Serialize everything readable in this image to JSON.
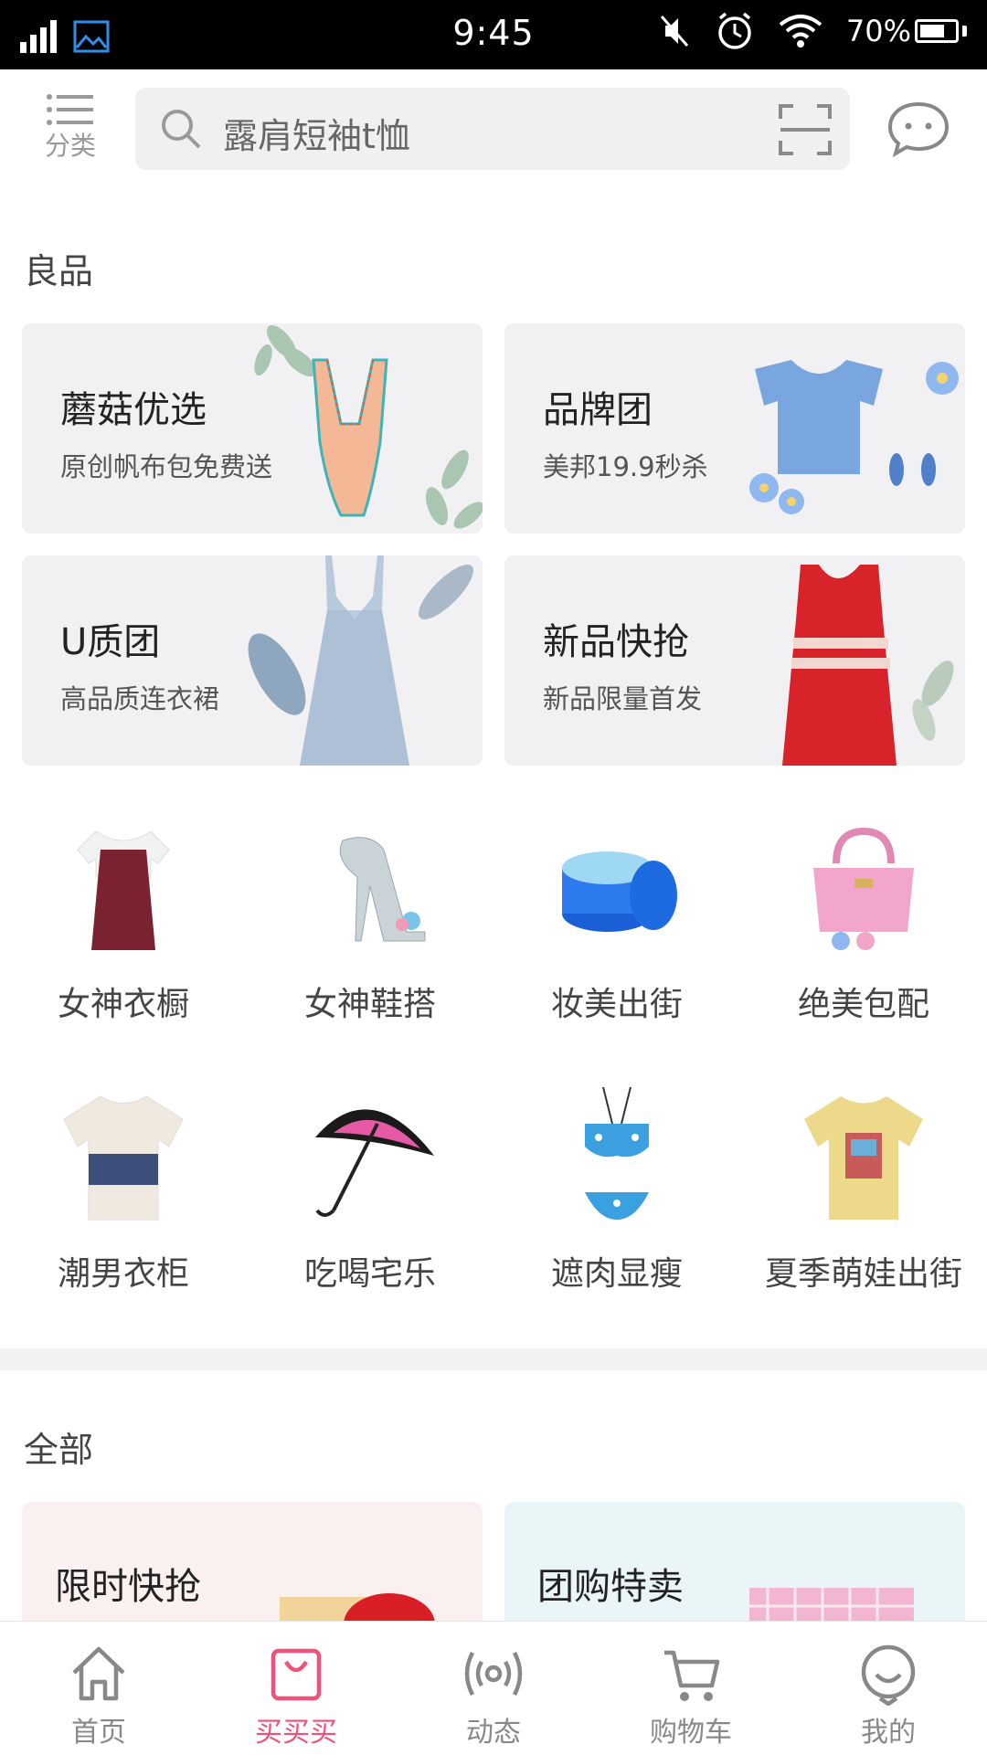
{
  "status_bar": {
    "time": "9:45",
    "battery": "70%"
  },
  "topbar": {
    "category_label": "分类",
    "search_placeholder": "露肩短袖t恤"
  },
  "sections": {
    "good_products": "良品",
    "all": "全部"
  },
  "feature_cards": [
    {
      "title": "蘑菇优选",
      "subtitle": "原创帆布包免费送"
    },
    {
      "title": "品牌团",
      "subtitle": "美邦19.9秒杀"
    },
    {
      "title": "U质团",
      "subtitle": "高品质连衣裙"
    },
    {
      "title": "新品快抢",
      "subtitle": "新品限量首发"
    }
  ],
  "categories": [
    {
      "label": "女神衣橱",
      "icon": "dress-icon"
    },
    {
      "label": "女神鞋搭",
      "icon": "heel-shoe-icon"
    },
    {
      "label": "妆美出街",
      "icon": "cosmetics-jar-icon"
    },
    {
      "label": "绝美包配",
      "icon": "handbag-icon"
    },
    {
      "label": "潮男衣柜",
      "icon": "tshirt-icon"
    },
    {
      "label": "吃喝宅乐",
      "icon": "umbrella-icon"
    },
    {
      "label": "遮肉显瘦",
      "icon": "bikini-icon"
    },
    {
      "label": "夏季萌娃出街",
      "icon": "kids-tshirt-icon"
    }
  ],
  "promos": [
    {
      "title": "限时快抢",
      "color": "#fbf0f0"
    },
    {
      "title": "团购特卖",
      "color": "#eaf5f8"
    }
  ],
  "bottom_nav": [
    {
      "label": "首页",
      "icon": "home-icon"
    },
    {
      "label": "买买买",
      "icon": "shopping-bag-icon",
      "active": true
    },
    {
      "label": "动态",
      "icon": "broadcast-icon"
    },
    {
      "label": "购物车",
      "icon": "cart-icon"
    },
    {
      "label": "我的",
      "icon": "profile-icon"
    }
  ],
  "colors": {
    "accent": "#f0507a",
    "card_bg": "#f1f1f3"
  }
}
